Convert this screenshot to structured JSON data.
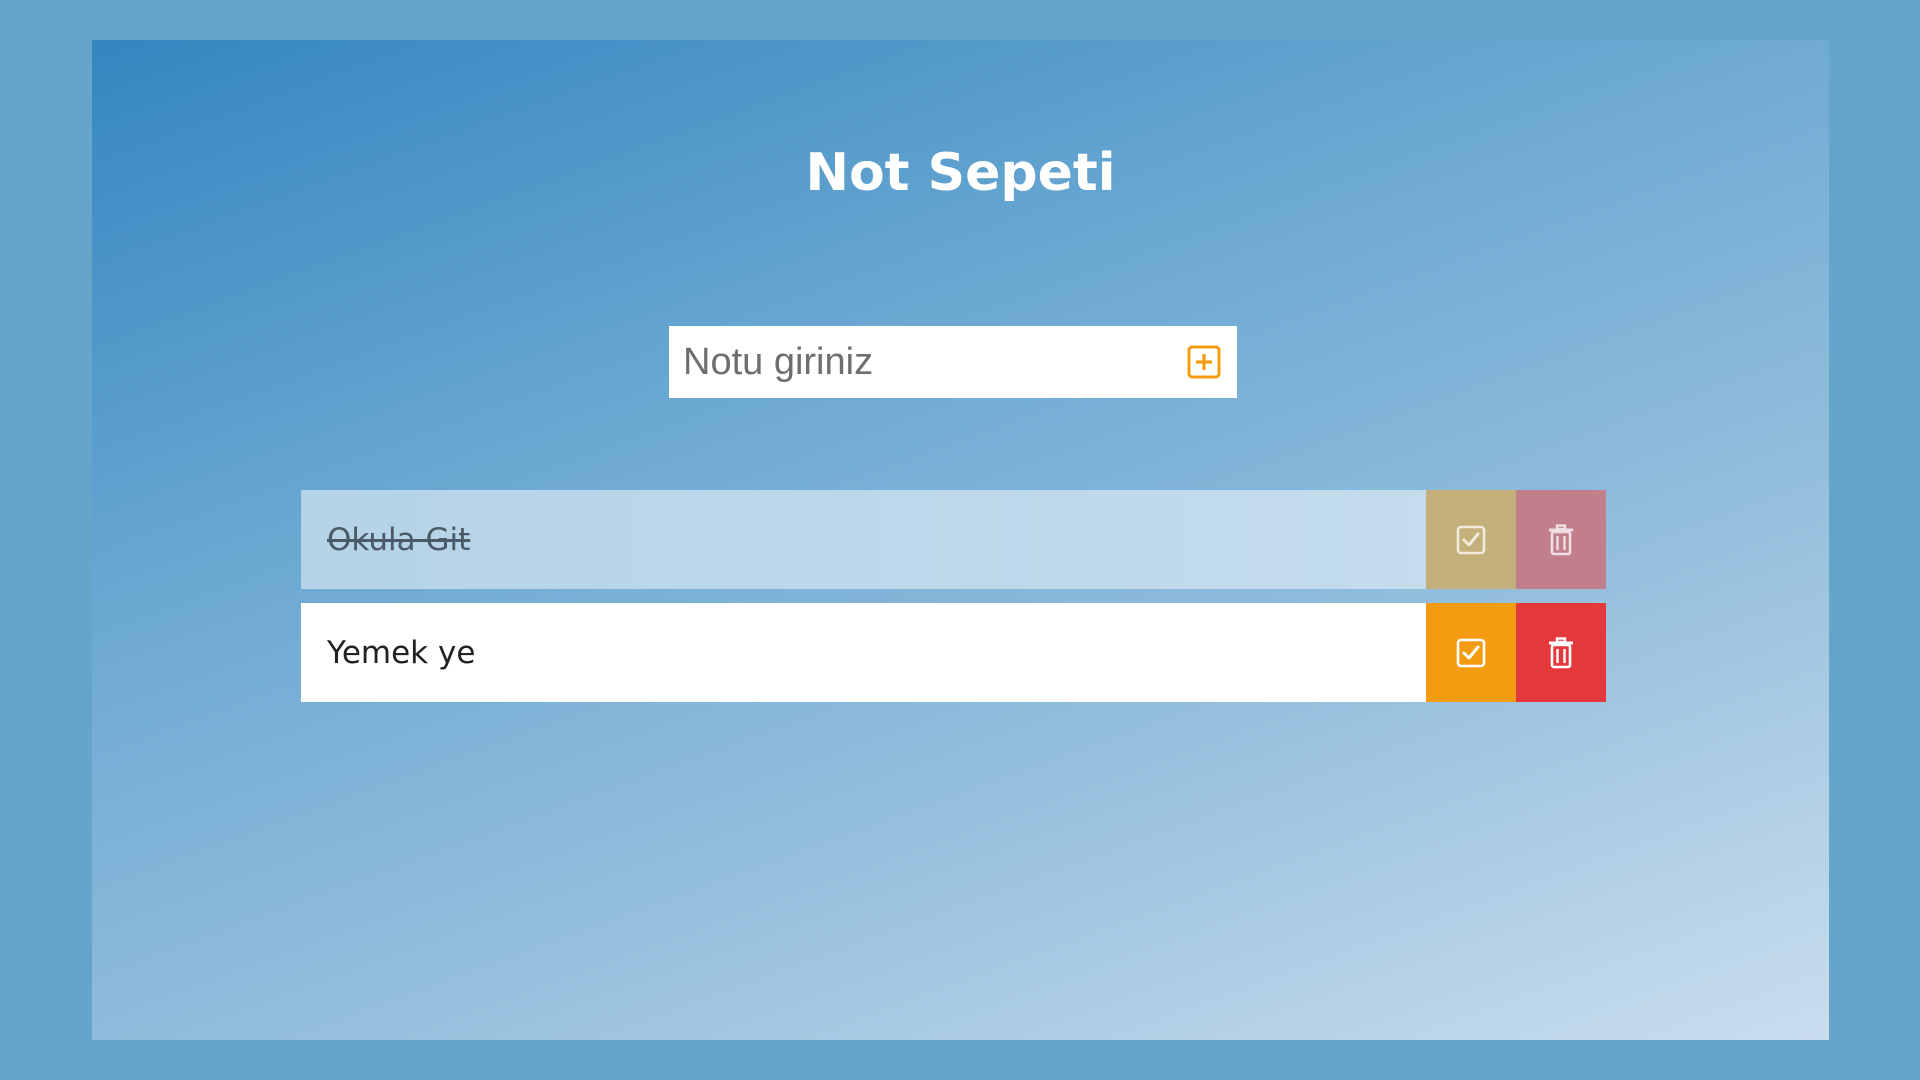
{
  "header": {
    "title": "Not Sepeti"
  },
  "form": {
    "placeholder": "Notu giriniz",
    "value": "",
    "add_icon": "plus-square-icon",
    "accent_color": "#f39c12"
  },
  "todos": [
    {
      "text": "Okula Git",
      "completed": true,
      "check_icon": "check-square-icon",
      "delete_icon": "trash-icon"
    },
    {
      "text": "Yemek ye",
      "completed": false,
      "check_icon": "check-square-icon",
      "delete_icon": "trash-icon"
    }
  ],
  "colors": {
    "page_background": "#64a5c9",
    "check_button": "#f39c12",
    "delete_button": "#e5383b"
  }
}
